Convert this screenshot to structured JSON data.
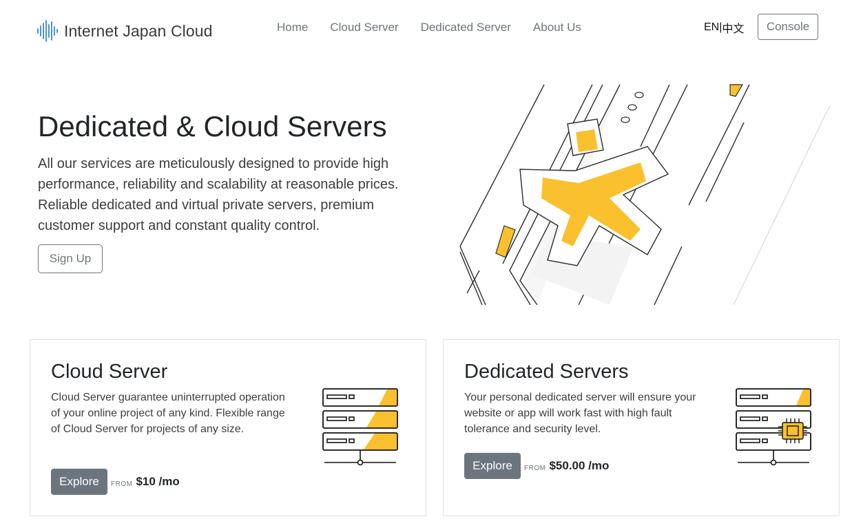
{
  "nav": {
    "brand": "Internet Japan Cloud",
    "links": [
      "Home",
      "Cloud Server",
      "Dedicated Server",
      "About Us"
    ],
    "lang_en": "EN",
    "lang_sep": "|",
    "lang_zh": "中文",
    "console": "Console"
  },
  "hero": {
    "title": "Dedicated & Cloud Servers",
    "description": "All our services are meticulously designed to provide high performance, reliability and scalability at reasonable prices. Reliable dedicated and virtual private servers, premium customer support and constant quality control.",
    "signup": "Sign Up"
  },
  "cards": [
    {
      "title": "Cloud Server",
      "text": "Cloud Server guarantee uninterrupted operation of your online project of any kind. Flexible range of Cloud Server for projects of any size.",
      "button": "Explore",
      "from": "FROM",
      "price": "$10 /mo"
    },
    {
      "title": "Dedicated Servers",
      "text": "Your personal dedicated server will ensure your website or app will work fast with high fault tolerance and security level.",
      "button": "Explore",
      "from": "FROM",
      "price": "$50.00 /mo"
    }
  ],
  "colors": {
    "accent": "#fbc02d",
    "button_grey": "#6c757d",
    "brand_wave": "#4a90e2"
  },
  "icons": {
    "brand": "sound-wave-icon",
    "cloud_card": "server-rack-icon",
    "dedicated_card": "server-chip-icon"
  }
}
